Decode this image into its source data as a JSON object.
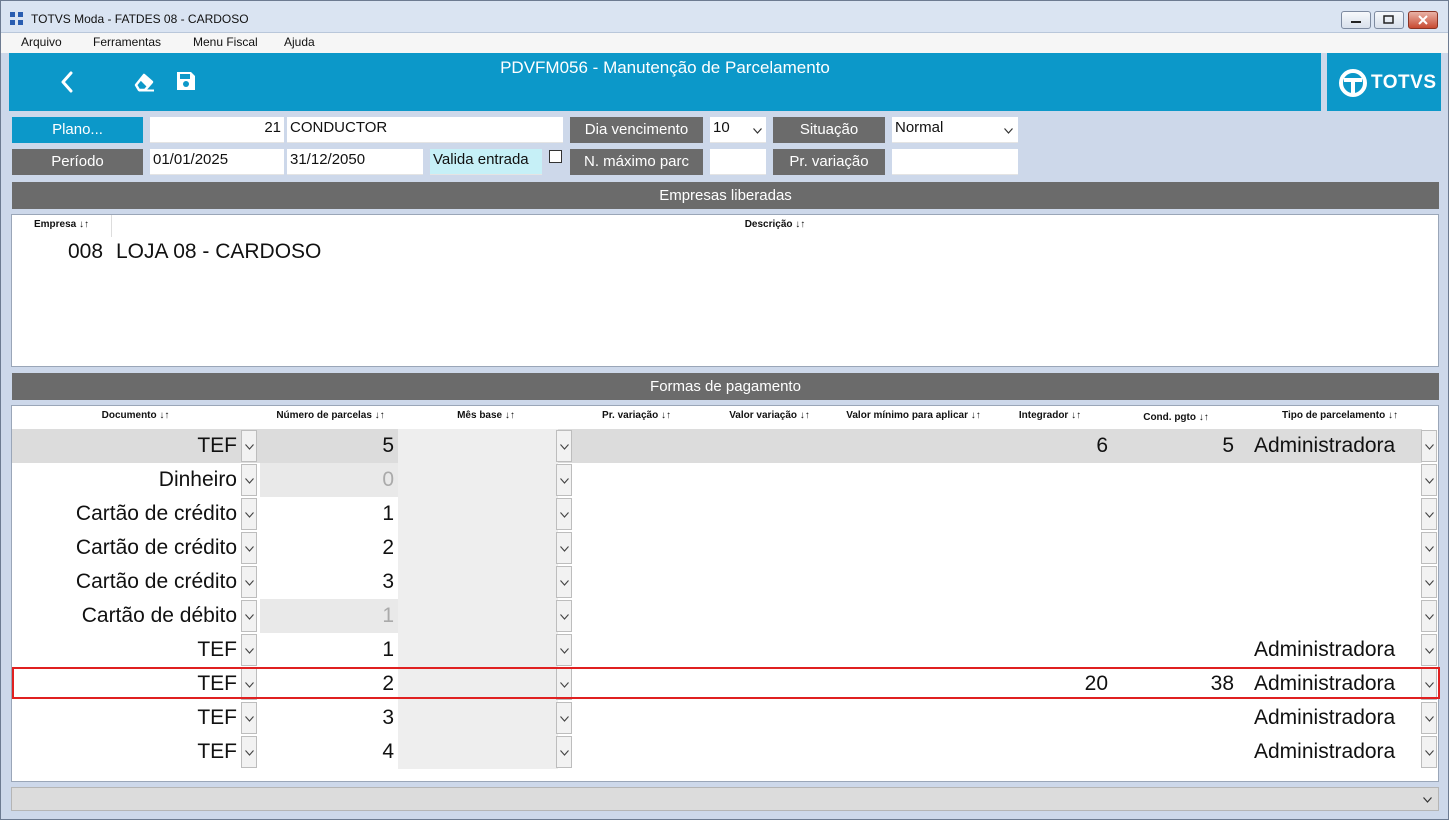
{
  "window": {
    "title": "TOTVS Moda - FATDES 08 - CARDOSO"
  },
  "menu": {
    "arquivo": "Arquivo",
    "ferramentas": "Ferramentas",
    "menu_fiscal": "Menu Fiscal",
    "ajuda": "Ajuda"
  },
  "header": {
    "title": "PDVFM056 - Manutenção de Parcelamento",
    "brand": "TOTVS",
    "icons": [
      "back-icon",
      "eraser-icon",
      "save-icon"
    ]
  },
  "form": {
    "plano_label": "Plano...",
    "plano_code": "21",
    "plano_name": "CONDUCTOR",
    "periodo_label": "Período",
    "periodo_inicio": "01/01/2025",
    "periodo_fim": "31/12/2050",
    "valida_entrada_label": "Valida entrada",
    "valida_entrada_checked": false,
    "dia_vencimento_label": "Dia vencimento",
    "dia_vencimento_value": "10",
    "n_maximo_label": "N. máximo parc",
    "n_maximo_value": "",
    "situacao_label": "Situação",
    "situacao_value": "Normal",
    "pr_variacao_label": "Pr. variação",
    "pr_variacao_value": ""
  },
  "empresas": {
    "section_title": "Empresas liberadas",
    "headers": {
      "empresa": "Empresa ↓↑",
      "descricao": "Descrição ↓↑"
    },
    "rows": [
      {
        "empresa": "008",
        "descricao": "LOJA 08 - CARDOSO"
      }
    ]
  },
  "formas": {
    "section_title": "Formas de pagamento",
    "headers": {
      "documento": "Documento ↓↑",
      "numero_parcelas": "Número de parcelas ↓↑",
      "mes_base": "Mês base ↓↑",
      "pr_variacao": "Pr. variação ↓↑",
      "valor_variacao": "Valor variação ↓↑",
      "valor_minimo": "Valor mínimo para aplicar ↓↑",
      "integrador": "Integrador ↓↑",
      "cond_pgto": "Cond. pgto ↓↑",
      "tipo_parcelamento": "Tipo de parcelamento ↓↑"
    },
    "rows": [
      {
        "documento": "TEF",
        "parcelas": "5",
        "integrador": "6",
        "cond_pgto": "5",
        "tipo": "Administradora"
      },
      {
        "documento": "Dinheiro",
        "parcelas": "0",
        "integrador": "",
        "cond_pgto": "",
        "tipo": ""
      },
      {
        "documento": "Cartão de crédito",
        "parcelas": "1",
        "integrador": "",
        "cond_pgto": "",
        "tipo": ""
      },
      {
        "documento": "Cartão de crédito",
        "parcelas": "2",
        "integrador": "",
        "cond_pgto": "",
        "tipo": ""
      },
      {
        "documento": "Cartão de crédito",
        "parcelas": "3",
        "integrador": "",
        "cond_pgto": "",
        "tipo": ""
      },
      {
        "documento": "Cartão de débito",
        "parcelas": "1",
        "integrador": "",
        "cond_pgto": "",
        "tipo": ""
      },
      {
        "documento": "TEF",
        "parcelas": "1",
        "integrador": "",
        "cond_pgto": "",
        "tipo": "Administradora"
      },
      {
        "documento": "TEF",
        "parcelas": "2",
        "integrador": "20",
        "cond_pgto": "38",
        "tipo": "Administradora"
      },
      {
        "documento": "TEF",
        "parcelas": "3",
        "integrador": "",
        "cond_pgto": "",
        "tipo": "Administradora"
      },
      {
        "documento": "TEF",
        "parcelas": "4",
        "integrador": "",
        "cond_pgto": "",
        "tipo": "Administradora"
      }
    ]
  },
  "colors": {
    "accent": "#0c98c9",
    "label_gray": "#6b6b6b",
    "highlight_border": "#e02020",
    "field_cyan": "#c6f0f7"
  }
}
